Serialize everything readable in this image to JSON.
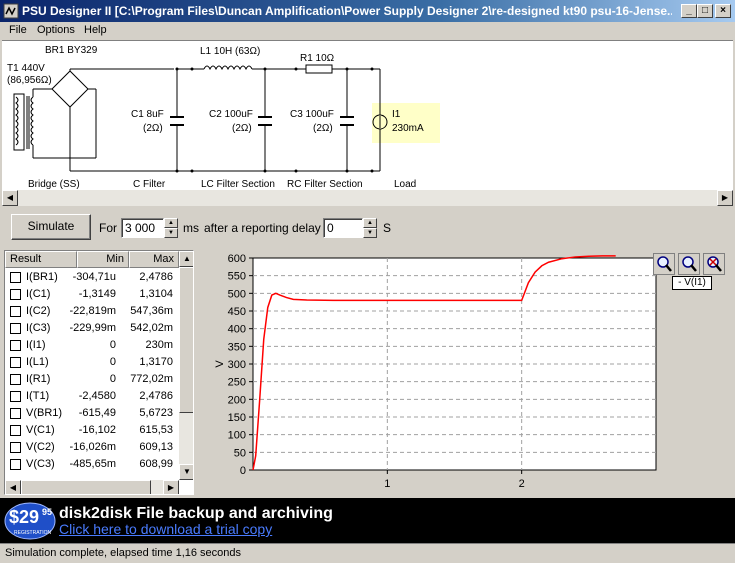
{
  "window": {
    "title": "PSU Designer II  [C:\\Program Files\\Duncan Amplification\\Power Supply Designer 2\\re-designed kt90 psu-16-Jense..."
  },
  "menu": [
    "File",
    "Options",
    "Help"
  ],
  "schematic": {
    "transformer": {
      "line1": "T1 440V",
      "line2": "(86,956Ω)"
    },
    "rectifier": "BR1 BY329",
    "inductor": "L1 10H (63Ω)",
    "resistor": "R1 10Ω",
    "c1": {
      "line1": "C1 8uF",
      "line2": "(2Ω)"
    },
    "c2": {
      "line1": "C2 100uF",
      "line2": "(2Ω)"
    },
    "c3": {
      "line1": "C3 100uF",
      "line2": "(2Ω)"
    },
    "load": {
      "line1": "I1",
      "line2": "230mA"
    },
    "sections": [
      "Bridge (SS)",
      "C Filter",
      "LC Filter Section",
      "RC Filter Section",
      "Load"
    ]
  },
  "controls": {
    "simulate_label": "Simulate",
    "for_label": "For",
    "duration_value": "3 000",
    "duration_unit": "ms",
    "delay_label": "after a reporting delay of",
    "delay_value": "0",
    "delay_unit": "S"
  },
  "results": {
    "headers": [
      "Result",
      "Min",
      "Max"
    ],
    "rows": [
      {
        "name": "I(BR1)",
        "min": "-304,71u",
        "max": "2,4786"
      },
      {
        "name": "I(C1)",
        "min": "-1,3149",
        "max": "1,3104"
      },
      {
        "name": "I(C2)",
        "min": "-22,819m",
        "max": "547,36m"
      },
      {
        "name": "I(C3)",
        "min": "-229,99m",
        "max": "542,02m"
      },
      {
        "name": "I(I1)",
        "min": "0",
        "max": "230m"
      },
      {
        "name": "I(L1)",
        "min": "0",
        "max": "1,3170"
      },
      {
        "name": "I(R1)",
        "min": "0",
        "max": "772,02m"
      },
      {
        "name": "I(T1)",
        "min": "-2,4580",
        "max": "2,4786"
      },
      {
        "name": "V(BR1)",
        "min": "-615,49",
        "max": "5,6723"
      },
      {
        "name": "V(C1)",
        "min": "-16,102",
        "max": "615,53"
      },
      {
        "name": "V(C2)",
        "min": "-16,026m",
        "max": "609,13"
      },
      {
        "name": "V(C3)",
        "min": "-485,65m",
        "max": "608,99"
      }
    ]
  },
  "chart_data": {
    "type": "line",
    "ylabel": "V",
    "xlabel": "",
    "xlim": [
      0,
      3
    ],
    "ylim": [
      0,
      600
    ],
    "yticks": [
      0,
      50,
      100,
      150,
      200,
      250,
      300,
      350,
      400,
      450,
      500,
      550,
      600
    ],
    "xticks": [
      1,
      2
    ],
    "grid": true,
    "legend": "- V(I1)",
    "series": [
      {
        "name": "V(I1)",
        "color": "#ff0000",
        "x": [
          0,
          0.02,
          0.05,
          0.08,
          0.11,
          0.14,
          0.17,
          0.2,
          0.25,
          0.3,
          0.4,
          0.6,
          1.0,
          1.5,
          2.0,
          2.02,
          2.05,
          2.1,
          2.15,
          2.2,
          2.3,
          2.4,
          2.5,
          2.6,
          2.7
        ],
        "values": [
          0,
          40,
          200,
          370,
          460,
          495,
          500,
          495,
          488,
          483,
          481,
          480,
          480,
          480,
          480,
          500,
          530,
          560,
          578,
          588,
          598,
          603,
          605,
          606,
          606
        ]
      }
    ]
  },
  "zoom": {
    "zoom_in": "zoom-in",
    "zoom_out": "zoom-out",
    "zoom_reset": "zoom-reset"
  },
  "banner": {
    "price_main": "$29",
    "price_cents": "95",
    "price_note": "REGISTRATION",
    "headline": "disk2disk File backup and archiving",
    "link": "Click here to download a trial copy"
  },
  "status": "Simulation complete, elapsed time 1,16 seconds",
  "colors": {
    "trace": "#ff0000",
    "load_highlight": "#ffffc8",
    "titlebar": "#0a246a",
    "banner_link": "#4a7cff"
  }
}
